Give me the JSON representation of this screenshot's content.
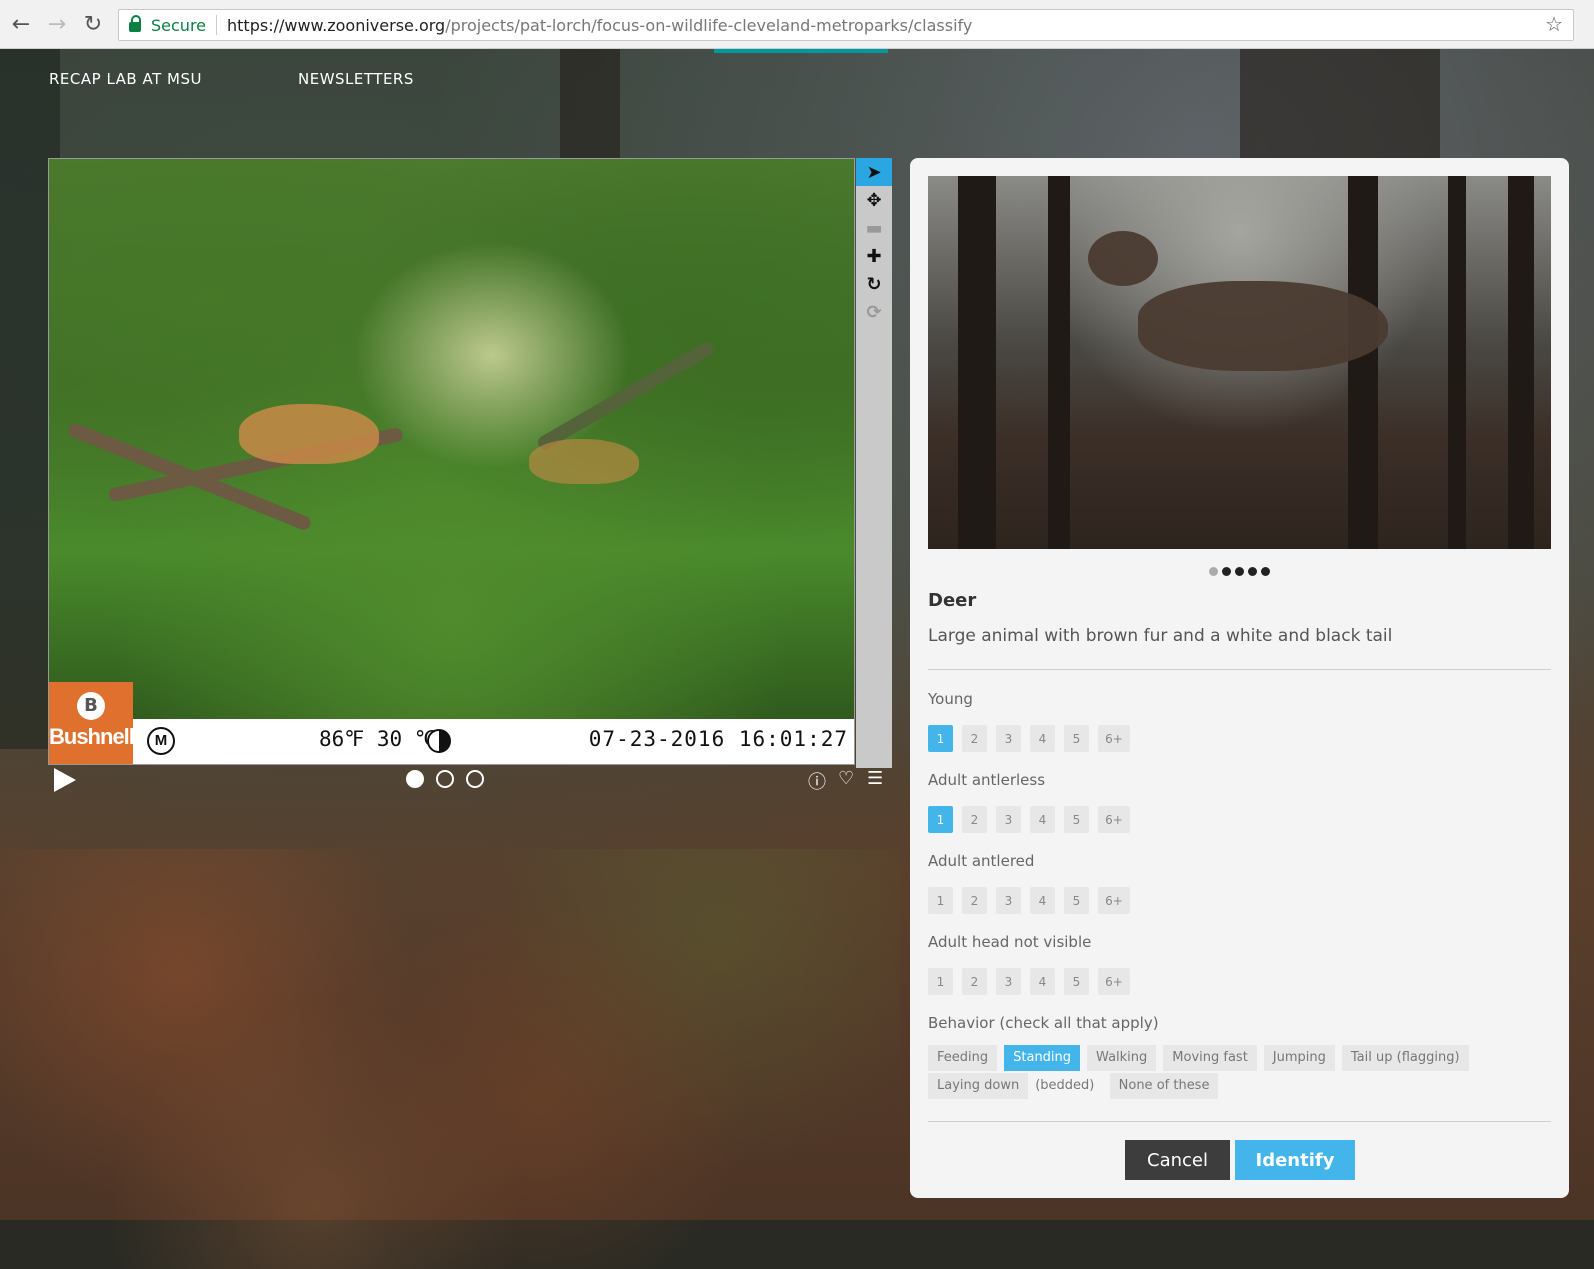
{
  "browser": {
    "secure_label": "Secure",
    "url_host": "https://www.zooniverse.org",
    "url_path": "/projects/pat-lorch/focus-on-wildlife-cleveland-metroparks/classify"
  },
  "nav": {
    "links": [
      "RECAP LAB AT MSU",
      "NEWSLETTERS"
    ]
  },
  "subject": {
    "camera_brand": "Bushnell",
    "camera_brand_logo": "B",
    "camera_mode": "M",
    "temperature": "86℉ 30 ℃",
    "timestamp": "07-23-2016 16:01:27",
    "frames": 3,
    "current_frame": 1
  },
  "toolbar": {
    "tools": [
      "pointer-icon",
      "pan-icon",
      "zoom-out-icon",
      "zoom-in-icon",
      "rotate-icon",
      "reset-icon"
    ]
  },
  "field_guide": {
    "animal_name": "Deer",
    "description": "Large animal with brown fur and a white and black tail",
    "photo_count": 5,
    "photo_active_index": 1,
    "questions": [
      {
        "label": "Young",
        "options": [
          "1",
          "2",
          "3",
          "4",
          "5",
          "6+"
        ],
        "selected": "1"
      },
      {
        "label": "Adult antlerless",
        "options": [
          "1",
          "2",
          "3",
          "4",
          "5",
          "6+"
        ],
        "selected": "1"
      },
      {
        "label": "Adult antlered",
        "options": [
          "1",
          "2",
          "3",
          "4",
          "5",
          "6+"
        ],
        "selected": null
      },
      {
        "label": "Adult head not visible",
        "options": [
          "1",
          "2",
          "3",
          "4",
          "5",
          "6+"
        ],
        "selected": null
      }
    ],
    "behavior_label": "Behavior (check all that apply)",
    "behaviors": [
      "Feeding",
      "Standing",
      "Walking",
      "Moving fast",
      "Jumping",
      "Tail up (flagging)",
      "Laying down",
      "None of these"
    ],
    "behavior_wrap_text": "(bedded)",
    "behavior_selected": "Standing",
    "cancel_label": "Cancel",
    "identify_label": "Identify"
  },
  "colors": {
    "accent": "#43b5ea",
    "tool_active": "#2aa7e0",
    "secure_green": "#0b8043",
    "camera_orange": "#e0702d"
  }
}
